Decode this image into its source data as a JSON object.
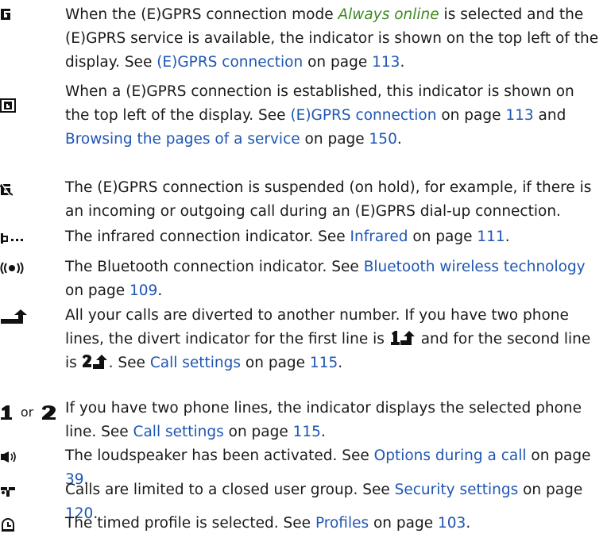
{
  "entries": [
    {
      "icon": "gprs-available-icon",
      "p1": "When the (E)GPRS connection mode ",
      "em1": "Always online",
      "p2": " is selected and the (E)GPRS service is available, the indicator is shown on the top left of the display. See ",
      "l1": "(E)GPRS connection",
      "p3": " on page ",
      "l2": "113",
      "p4": "."
    },
    {
      "icon": "gprs-connected-icon",
      "p1": " When a (E)GPRS connection is established, this indicator is shown on the top left of the display. See ",
      "l1": "(E)GPRS connection",
      "p2": " on page ",
      "l2": "113",
      "p3": " and ",
      "l3": "Browsing the pages of a service",
      "p4": " on page ",
      "l4": "150",
      "p5": "."
    },
    {
      "icon": "gprs-suspended-icon",
      "p1": "The (E)GPRS connection is suspended (on hold), for example, if there is an incoming or outgoing call during an (E)GPRS dial-up connection."
    },
    {
      "icon": "infrared-icon",
      "p1": "The infrared connection indicator. See ",
      "l1": "Infrared",
      "p2": " on page ",
      "l2": "111",
      "p3": "."
    },
    {
      "icon": "bluetooth-icon",
      "p1": "The Bluetooth connection indicator. See ",
      "l1": "Bluetooth wireless technology",
      "p2": " on page ",
      "l2": "109",
      "p3": "."
    },
    {
      "icon": "divert-icon",
      "p1": "All your calls are diverted to another number. If you have two phone lines, the divert indicator for the first line is ",
      "p2": " and for the second line is ",
      "p3": ". See ",
      "l1": "Call settings",
      "p4": " on page ",
      "l2": "115",
      "p5": "."
    },
    {
      "icon": "phone-line-icon",
      "or": "or",
      "p1": "If you have two phone lines, the indicator displays the selected phone line. See ",
      "l1": "Call settings",
      "p2": " on page ",
      "l2": "115",
      "p3": "."
    },
    {
      "icon": "loudspeaker-icon",
      "p1": "The loudspeaker has been activated. See ",
      "l1": "Options during a call",
      "p2": " on page ",
      "l2": "39",
      "p3": "."
    },
    {
      "icon": "closed-user-group-icon",
      "p1": "Calls are limited to a closed user group. See ",
      "l1": "Security settings",
      "p2": " on page ",
      "l2": "120",
      "p3": "."
    },
    {
      "icon": "timed-profile-icon",
      "p1": "The timed profile is selected. See ",
      "l1": "Profiles",
      "p2": " on page ",
      "l2": "103",
      "p3": "."
    }
  ],
  "colors": {
    "link": "#1f56b3",
    "emphasis": "#3a8a1f",
    "text": "#1a1a1a"
  }
}
